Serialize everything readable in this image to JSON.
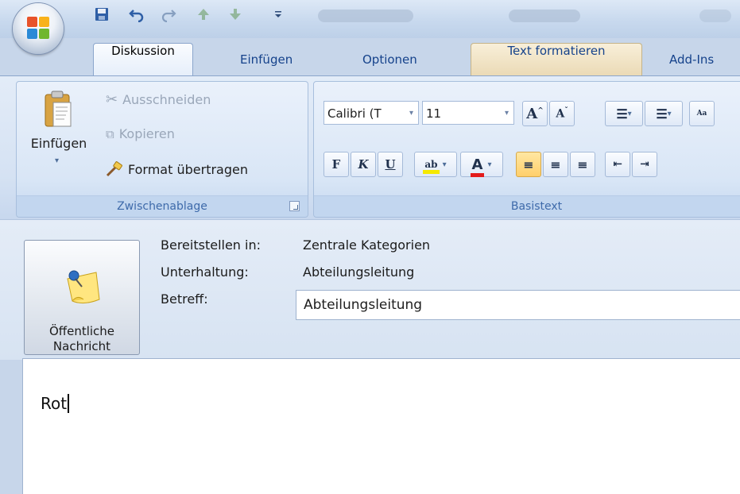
{
  "window": {
    "icon": "office-button",
    "qat": [
      "save-icon",
      "undo-icon",
      "redo-icon",
      "up-icon",
      "down-icon",
      "customize-icon"
    ]
  },
  "tabs": [
    {
      "label": "Diskussion",
      "active": true
    },
    {
      "label": "Einfügen"
    },
    {
      "label": "Optionen"
    },
    {
      "label": "Text formatieren",
      "contextual": true
    },
    {
      "label": "Add-Ins"
    }
  ],
  "clipboard": {
    "paste_label": "Einfügen",
    "cut_label": "Ausschneiden",
    "copy_label": "Kopieren",
    "format_painter_label": "Format übertragen",
    "group_label": "Zwischenablage"
  },
  "basic_text": {
    "font_name": "Calibri (T",
    "font_size": "11",
    "bold": "F",
    "italic": "K",
    "underline": "U",
    "highlight_glyph": "ab",
    "font_color_glyph": "A",
    "highlight_color": "#f5e900",
    "font_color": "#e31b1b",
    "group_label": "Basistext"
  },
  "header": {
    "public_button_line1": "Öffentliche",
    "public_button_line2": "Nachricht",
    "post_to_label": "Bereitstellen in:",
    "post_to_value": "Zentrale Kategorien",
    "conversation_label": "Unterhaltung:",
    "conversation_value": "Abteilungsleitung",
    "subject_label": "Betreff:",
    "subject_value": "Abteilungsleitung"
  },
  "body": {
    "text": "Rot"
  }
}
